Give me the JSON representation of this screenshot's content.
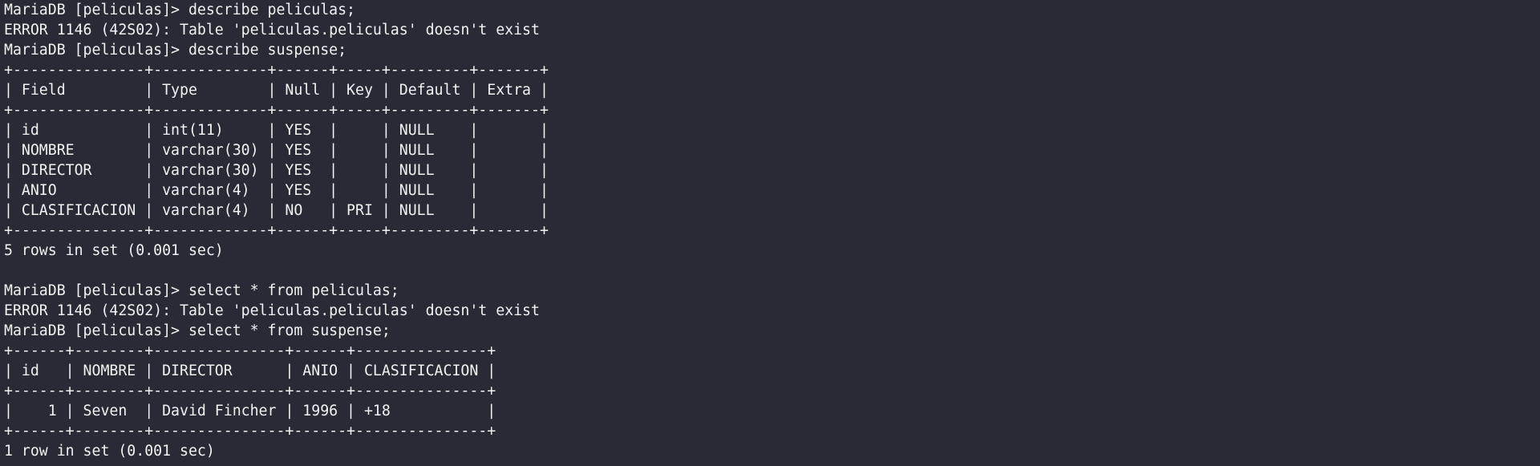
{
  "terminal": {
    "lines": [
      "MariaDB [peliculas]> describe peliculas;",
      "ERROR 1146 (42S02): Table 'peliculas.peliculas' doesn't exist",
      "MariaDB [peliculas]> describe suspense;",
      "+---------------+-------------+------+-----+---------+-------+",
      "| Field         | Type        | Null | Key | Default | Extra |",
      "+---------------+-------------+------+-----+---------+-------+",
      "| id            | int(11)     | YES  |     | NULL    |       |",
      "| NOMBRE        | varchar(30) | YES  |     | NULL    |       |",
      "| DIRECTOR      | varchar(30) | YES  |     | NULL    |       |",
      "| ANIO          | varchar(4)  | YES  |     | NULL    |       |",
      "| CLASIFICACION | varchar(4)  | NO   | PRI | NULL    |       |",
      "+---------------+-------------+------+-----+---------+-------+",
      "5 rows in set (0.001 sec)",
      "",
      "MariaDB [peliculas]> select * from peliculas;",
      "ERROR 1146 (42S02): Table 'peliculas.peliculas' doesn't exist",
      "MariaDB [peliculas]> select * from suspense;",
      "+------+--------+---------------+------+---------------+",
      "| id   | NOMBRE | DIRECTOR      | ANIO | CLASIFICACION |",
      "+------+--------+---------------+------+---------------+",
      "|    1 | Seven  | David Fincher | 1996 | +18           |",
      "+------+--------+---------------+------+---------------+",
      "1 row in set (0.001 sec)"
    ]
  }
}
